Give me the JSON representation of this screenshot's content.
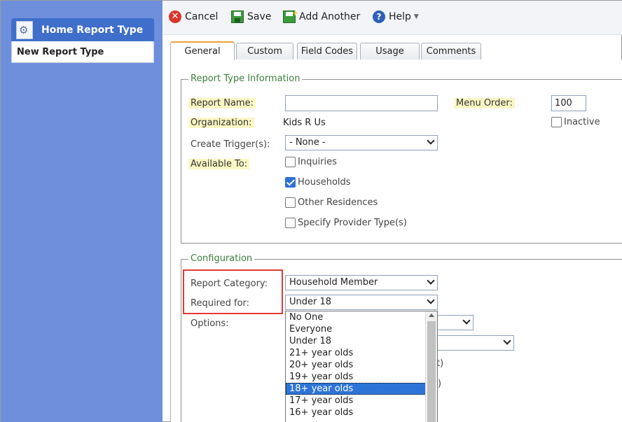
{
  "sidebar": {
    "title": "Home Report Type",
    "subtitle": "New Report Type"
  },
  "toolbar": {
    "cancel": "Cancel",
    "save": "Save",
    "add_another": "Add Another",
    "help": "Help"
  },
  "tabs": [
    "General",
    "Custom",
    "Field Codes",
    "Usage",
    "Comments"
  ],
  "report_type_info": {
    "legend": "Report Type Information",
    "report_name_label": "Report Name:",
    "report_name_value": "",
    "menu_order_label": "Menu Order:",
    "menu_order_value": "100",
    "inactive_label": "Inactive",
    "organization_label": "Organization:",
    "organization_value": "Kids R Us",
    "create_trigger_label": "Create Trigger(s):",
    "create_trigger_value": "- None -",
    "available_to_label": "Available To:",
    "available": {
      "inquiries": "Inquiries",
      "households": "Households",
      "other_residences": "Other Residences",
      "specify_provider": "Specify Provider Type(s)"
    }
  },
  "configuration": {
    "legend": "Configuration",
    "report_category_label": "Report Category:",
    "report_category_value": "Household Member",
    "required_for_label": "Required for:",
    "required_for_value": "Under 18",
    "options_label": "Options:",
    "partial_text_1": "t)",
    "partial_text_2": ")"
  },
  "dropdown_options": [
    "No One",
    "Everyone",
    "Under 18",
    "21+ year olds",
    "20+ year olds",
    "19+ year olds",
    "18+ year olds",
    "17+ year olds",
    "16+ year olds"
  ],
  "highlighted_option": "18+ year olds"
}
